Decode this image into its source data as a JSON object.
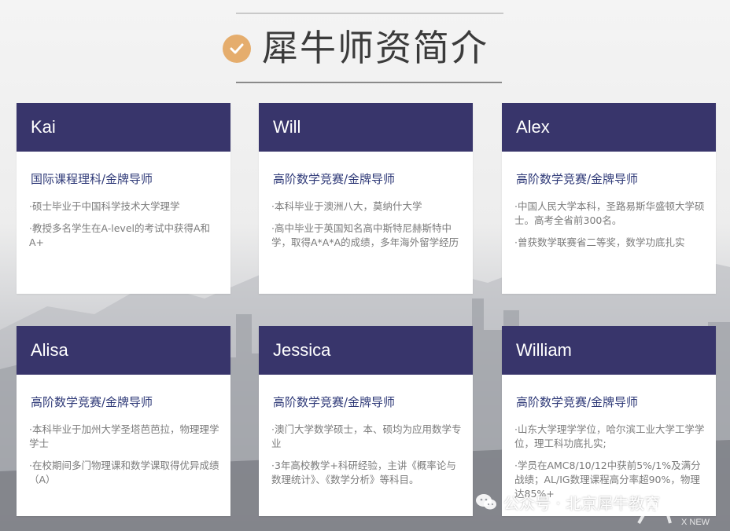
{
  "page": {
    "title": "犀牛师资简介"
  },
  "teachers": [
    {
      "name": "Kai",
      "role": "国际课程理科/金牌导师",
      "bullets": [
        "·硕士毕业于中国科学技术大学理学",
        "·教授多名学生在A-level的考试中获得A和A+"
      ]
    },
    {
      "name": "Will",
      "role": "高阶数学竞赛/金牌导师",
      "bullets": [
        "·本科毕业于澳洲八大，莫纳什大学",
        "·高中毕业于英国知名高中斯特尼赫斯特中学，取得A*A*A的成绩，多年海外留学经历"
      ]
    },
    {
      "name": "Alex",
      "role": "高阶数学竞赛/金牌导师",
      "bullets": [
        "·中国人民大学本科，圣路易斯华盛顿大学硕士。高考全省前300名。",
        "·曾获数学联赛省二等奖，数学功底扎实"
      ]
    },
    {
      "name": "Alisa",
      "role": "高阶数学竞赛/金牌导师",
      "bullets": [
        "·本科毕业于加州大学圣塔芭芭拉，物理理学学士",
        "·在校期间多门物理课和数学课取得优异成绩（A）"
      ]
    },
    {
      "name": "Jessica",
      "role": "高阶数学竞赛/金牌导师",
      "bullets": [
        "·澳门大学数学硕士，本、硕均为应用数学专业",
        "·3年高校教学+科研经验，主讲《概率论与数理统计》、《数学分析》等科目。"
      ]
    },
    {
      "name": "William",
      "role": "高阶数学竞赛/金牌导师",
      "bullets": [
        "·山东大学理学学位，哈尔滨工业大学工学学位，理工科功底扎实;",
        "·学员在AMC8/10/12中获前5%/1%及满分战绩；AL/IG数理课程高分率超90%，物理达85%+"
      ]
    }
  ],
  "watermark": {
    "text": "公众号 · 北京犀牛教育",
    "icon": "wechat-icon",
    "logo_text": "X NEW"
  },
  "colors": {
    "header": "#38356b",
    "role": "#2f3a78",
    "accent": "#e5ad6d"
  }
}
